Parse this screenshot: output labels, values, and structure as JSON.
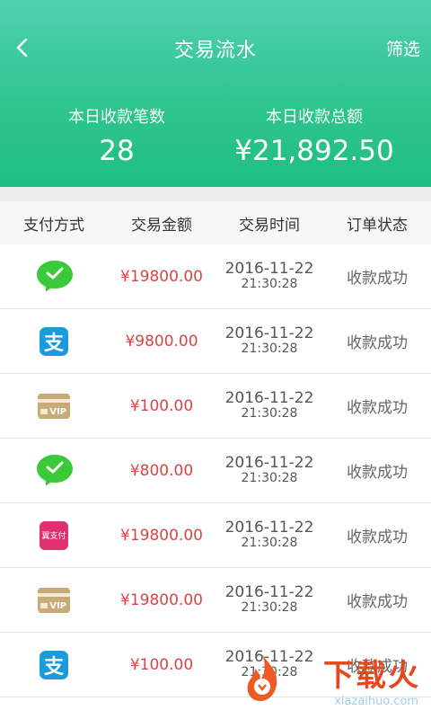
{
  "header": {
    "title": "交易流水",
    "filter_label": "筛选",
    "stats": {
      "count_label": "本日收款笔数",
      "count_value": "28",
      "amount_label": "本日收款总额",
      "amount_value": "¥21,892.50"
    }
  },
  "table": {
    "columns": [
      "支付方式",
      "交易金额",
      "交易时间",
      "订单状态"
    ],
    "rows": [
      {
        "payment_icon": "wechat-pay-icon",
        "amount": "¥19800.00",
        "date": "2016-11-22",
        "time": "21:30:28",
        "status": "收款成功"
      },
      {
        "payment_icon": "alipay-icon",
        "amount": "¥9800.00",
        "date": "2016-11-22",
        "time": "21:30:28",
        "status": "收款成功"
      },
      {
        "payment_icon": "vip-card-icon",
        "card_text": "VIP",
        "amount": "¥100.00",
        "date": "2016-11-22",
        "time": "21:30:28",
        "status": "收款成功"
      },
      {
        "payment_icon": "wechat-pay-icon",
        "amount": "¥800.00",
        "date": "2016-11-22",
        "time": "21:30:28",
        "status": "收款成功"
      },
      {
        "payment_icon": "yipay-icon",
        "icon_text": "翼支付",
        "amount": "¥19800.00",
        "date": "2016-11-22",
        "time": "21:30:28",
        "status": "收款成功"
      },
      {
        "payment_icon": "vip-card-icon",
        "card_text": "VIP",
        "amount": "¥19800.00",
        "date": "2016-11-22",
        "time": "21:30:28",
        "status": "收款成功"
      },
      {
        "payment_icon": "alipay-icon",
        "amount": "¥100.00",
        "date": "2016-11-22",
        "time": "21:30:28",
        "status": "收款成功"
      }
    ]
  },
  "alipay_glyph": "支",
  "watermark": {
    "text": "下载火",
    "url": "xiazaihuo.com"
  },
  "colors": {
    "header_gradient_top": "#4fd0b0",
    "header_gradient_bottom": "#1fbe84",
    "amount": "#d64545",
    "wechat": "#39c939",
    "alipay": "#1a9bdc",
    "vip_card": "#c8aa78",
    "yipay": "#e0306f"
  }
}
